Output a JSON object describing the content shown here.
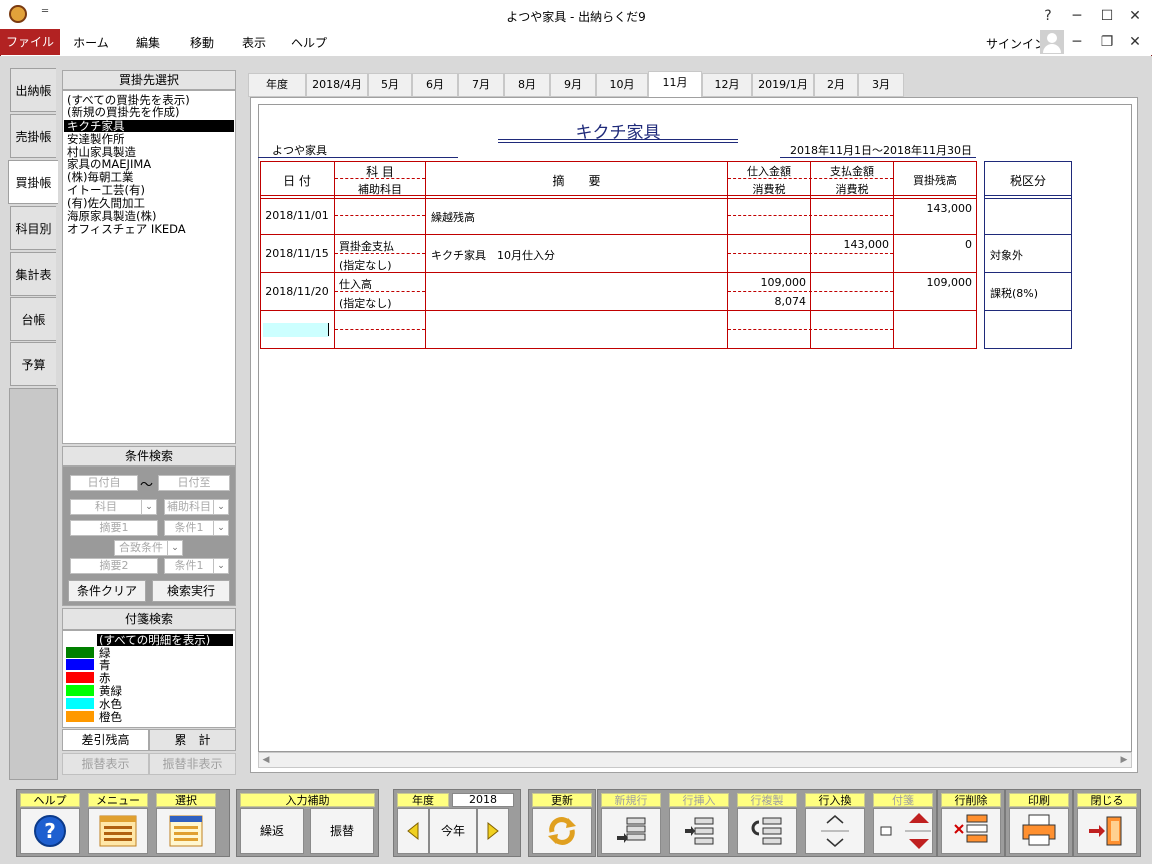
{
  "window": {
    "title": "よつや家具 - 出納らくだ9"
  },
  "titlebar_buttons": [
    "?",
    "─",
    "☐",
    "✕"
  ],
  "menu": {
    "file": "ファイル",
    "items": [
      "ホーム",
      "編集",
      "移動",
      "表示",
      "ヘルプ"
    ],
    "signin": "サインイン"
  },
  "side_tabs": [
    "出納帳",
    "売掛帳",
    "買掛帳",
    "科目別",
    "集計表",
    "台帳",
    "予算"
  ],
  "vendor_panel": {
    "header": "買掛先選択",
    "items": [
      "(すべての買掛先を表示)",
      "(新規の買掛先を作成)",
      "キクチ家具",
      "安達製作所",
      "村山家具製造",
      "家具のMAEJIMA",
      "(株)毎朝工業",
      "イトー工芸(有)",
      "(有)佐久間加工",
      "海原家具製造(株)",
      "オフィスチェア IKEDA"
    ],
    "selected_index": 2
  },
  "condition_search": {
    "header": "条件検索",
    "date_from": "日付自",
    "tilde": "〜",
    "date_to": "日付至",
    "account": "科目",
    "sub_account": "補助科目",
    "summary1": "摘要1",
    "cond1": "条件1",
    "match": "合致条件",
    "summary2": "摘要2",
    "cond2": "条件1",
    "clear_btn": "条件クリア",
    "exec_btn": "検索実行"
  },
  "tag_search": {
    "header": "付箋検索",
    "show_all": "(すべての明細を表示)",
    "colors": [
      {
        "label": "緑",
        "color": "#008000"
      },
      {
        "label": "青",
        "color": "#0000ff"
      },
      {
        "label": "赤",
        "color": "#ff0000"
      },
      {
        "label": "黄緑",
        "color": "#00ff00"
      },
      {
        "label": "水色",
        "color": "#00ffff"
      },
      {
        "label": "橙色",
        "color": "#ff9900"
      }
    ]
  },
  "bottom_tabs": {
    "balance": "差引残高",
    "cumulative": "累　計",
    "transfer_show": "振替表示",
    "transfer_hide": "振替非表示"
  },
  "month_tabs": [
    "年度",
    "2018/4月",
    "5月",
    "6月",
    "7月",
    "8月",
    "9月",
    "10月",
    "11月",
    "12月",
    "2019/1月",
    "2月",
    "3月"
  ],
  "active_month": "11月",
  "ledger": {
    "vendor_title": "キクチ家具",
    "company": "よつや家具",
    "period": "2018年11月1日〜2018年11月30日",
    "headers": {
      "date": "日 付",
      "account": "科 目",
      "sub_account": "補助科目",
      "summary": "摘　　要",
      "purchase": "仕入金額",
      "tax": "消費税",
      "payment": "支払金額",
      "tax2": "消費税",
      "balance": "買掛残高",
      "tax_class": "税区分"
    },
    "rows": [
      {
        "date": "2018/11/01",
        "account": "",
        "sub": "",
        "summary": "繰越残高",
        "purchase": "",
        "tax": "",
        "payment": "",
        "balance": "143,000",
        "tax_class": ""
      },
      {
        "date": "2018/11/15",
        "account": "買掛金支払",
        "sub": "(指定なし)",
        "summary": "キクチ家具　10月仕入分",
        "purchase": "",
        "tax": "",
        "payment": "143,000",
        "balance": "0",
        "tax_class": "対象外"
      },
      {
        "date": "2018/11/20",
        "account": "仕入高",
        "sub": "(指定なし)",
        "summary": "",
        "purchase": "109,000",
        "tax": "8,074",
        "payment": "",
        "balance": "109,000",
        "tax_class": "課税(8%)"
      }
    ]
  },
  "toolbar": {
    "help": "ヘルプ",
    "menu": "メニュー",
    "select": "選択",
    "input_assist": "入力補助",
    "repeat": "繰返",
    "transfer": "振替",
    "year_label": "年度",
    "year_value": "2018",
    "this_year": "今年",
    "refresh": "更新",
    "new_row": "新規行",
    "insert_row": "行挿入",
    "copy_row": "行複製",
    "swap_row": "行入換",
    "tag": "付箋",
    "delete_row": "行削除",
    "print": "印刷",
    "close": "閉じる"
  }
}
